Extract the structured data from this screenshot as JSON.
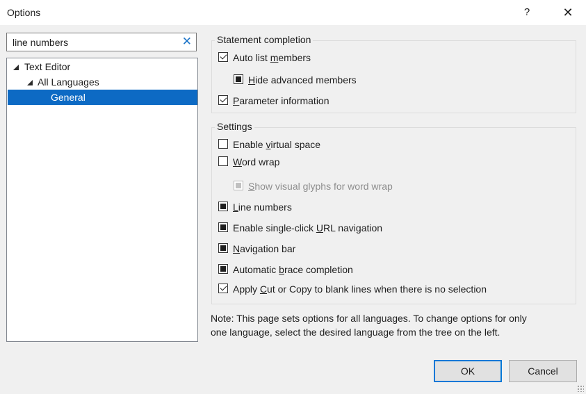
{
  "window": {
    "title": "Options",
    "help": "?",
    "close": "✕"
  },
  "search": {
    "value": "line numbers",
    "clear": "✕"
  },
  "tree": [
    {
      "label": "Text Editor",
      "expanded": true
    },
    {
      "label": "All Languages",
      "expanded": true
    },
    {
      "label": "General",
      "selected": true
    }
  ],
  "statement_completion": {
    "title": "Statement completion",
    "options": [
      {
        "pre": "Auto list ",
        "key": "m",
        "post": "embers",
        "state": "checked"
      },
      {
        "pre": "",
        "key": "H",
        "post": "ide advanced members",
        "state": "indeterminate"
      },
      {
        "pre": "",
        "key": "P",
        "post": "arameter information",
        "state": "checked"
      }
    ]
  },
  "settings": {
    "title": "Settings",
    "options": [
      {
        "pre": "Enable ",
        "key": "v",
        "post": "irtual space",
        "state": "unchecked"
      },
      {
        "pre": "",
        "key": "W",
        "post": "ord wrap",
        "state": "unchecked"
      },
      {
        "pre": "",
        "key": "S",
        "post": "how visual glyphs for word wrap",
        "state": "indeterminate",
        "disabled": true
      },
      {
        "pre": "",
        "key": "L",
        "post": "ine numbers",
        "state": "indeterminate"
      },
      {
        "pre": "Enable single-click ",
        "key": "U",
        "post": "RL navigation",
        "state": "indeterminate"
      },
      {
        "pre": "",
        "key": "N",
        "post": "avigation bar",
        "state": "indeterminate"
      },
      {
        "pre": "Automatic ",
        "key": "b",
        "post": "race completion",
        "state": "indeterminate"
      },
      {
        "pre": "Apply ",
        "key": "C",
        "post": "ut or Copy to blank lines when there is no selection",
        "state": "checked"
      }
    ]
  },
  "note": {
    "line1": "Note: This page sets options for all languages. To change options for only",
    "line2": "one language, select the desired language from the tree on the left."
  },
  "buttons": {
    "ok": "OK",
    "cancel": "Cancel"
  }
}
